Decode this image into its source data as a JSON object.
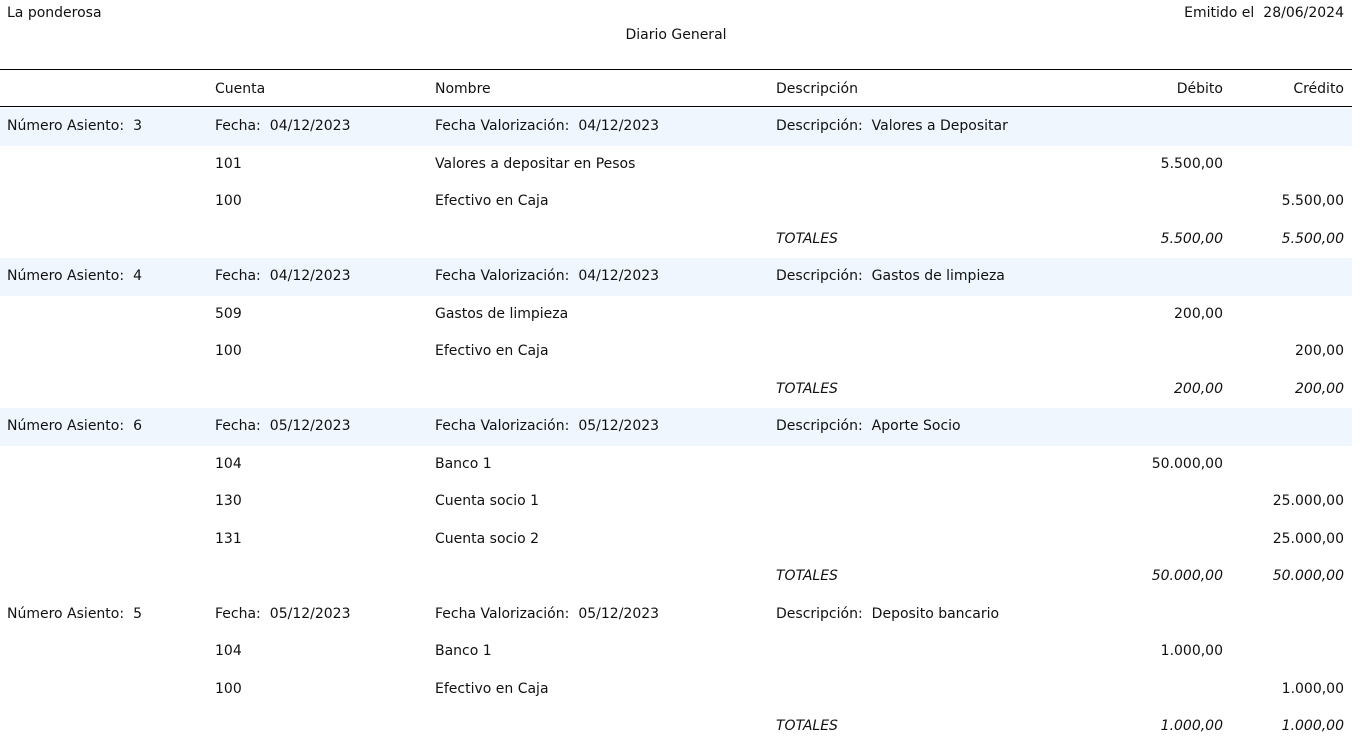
{
  "header": {
    "company": "La ponderosa",
    "emitted_label": "Emitido el",
    "emitted_date": "28/06/2024",
    "title": "Diario General"
  },
  "columns": {
    "cuenta": "Cuenta",
    "nombre": "Nombre",
    "descripcion": "Descripción",
    "debito": "Débito",
    "credito": "Crédito"
  },
  "labels": {
    "numero": "Número Asiento:",
    "fecha": "Fecha:",
    "fecha_val": "Fecha Valorización:",
    "descripcion": "Descripción:",
    "totales": "TOTALES"
  },
  "entries": [
    {
      "numero": "3",
      "fecha": "04/12/2023",
      "fecha_val": "04/12/2023",
      "descripcion": "Valores a Depositar",
      "lines": [
        {
          "cuenta": "101",
          "nombre": "Valores a depositar en Pesos",
          "debito": "5.500,00",
          "credito": ""
        },
        {
          "cuenta": "100",
          "nombre": "Efectivo en Caja",
          "debito": "",
          "credito": "5.500,00"
        }
      ],
      "total_debito": "5.500,00",
      "total_credito": "5.500,00"
    },
    {
      "numero": "4",
      "fecha": "04/12/2023",
      "fecha_val": "04/12/2023",
      "descripcion": "Gastos de limpieza",
      "lines": [
        {
          "cuenta": "509",
          "nombre": "Gastos de limpieza",
          "debito": "200,00",
          "credito": ""
        },
        {
          "cuenta": "100",
          "nombre": "Efectivo en Caja",
          "debito": "",
          "credito": "200,00"
        }
      ],
      "total_debito": "200,00",
      "total_credito": "200,00"
    },
    {
      "numero": "6",
      "fecha": "05/12/2023",
      "fecha_val": "05/12/2023",
      "descripcion": "Aporte Socio",
      "lines": [
        {
          "cuenta": "104",
          "nombre": "Banco 1",
          "debito": "50.000,00",
          "credito": ""
        },
        {
          "cuenta": "130",
          "nombre": "Cuenta socio 1",
          "debito": "",
          "credito": "25.000,00"
        },
        {
          "cuenta": "131",
          "nombre": "Cuenta socio 2",
          "debito": "",
          "credito": "25.000,00"
        }
      ],
      "total_debito": "50.000,00",
      "total_credito": "50.000,00"
    },
    {
      "numero": "5",
      "fecha": "05/12/2023",
      "fecha_val": "05/12/2023",
      "descripcion": "Deposito bancario",
      "lines": [
        {
          "cuenta": "104",
          "nombre": "Banco 1",
          "debito": "1.000,00",
          "credito": ""
        },
        {
          "cuenta": "100",
          "nombre": "Efectivo en Caja",
          "debito": "",
          "credito": "1.000,00"
        }
      ],
      "total_debito": "1.000,00",
      "total_credito": "1.000,00"
    }
  ]
}
